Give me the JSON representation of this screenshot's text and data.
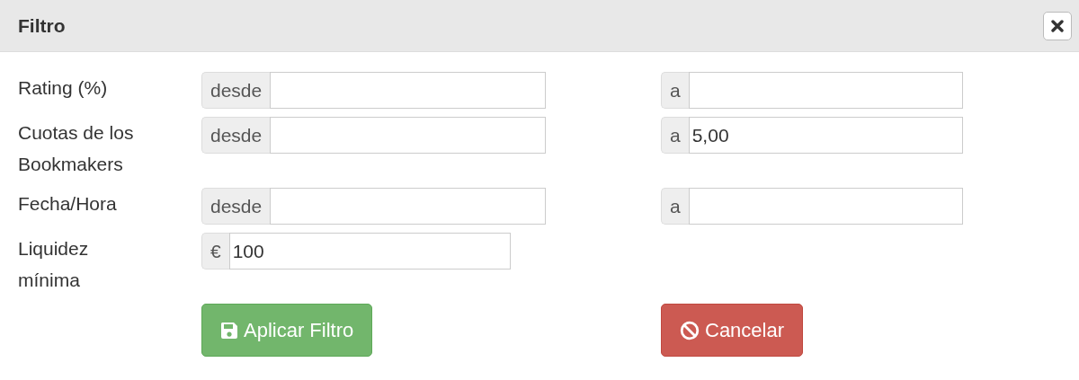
{
  "dialog": {
    "title": "Filtro"
  },
  "fields": [
    {
      "label": "Rating (%)",
      "inputs": [
        {
          "addon": "desde"
        },
        {
          "addon": "a"
        }
      ]
    },
    {
      "label": "Cuotas de los Bookmakers",
      "inputs": [
        {
          "addon": "desde"
        },
        {
          "addon": "a",
          "value": "5,00"
        }
      ]
    },
    {
      "label": "Fecha/Hora",
      "inputs": [
        {
          "addon": "desde"
        },
        {
          "addon": "a"
        }
      ]
    },
    {
      "label": "Liquidez mínima",
      "inputs": [
        {
          "addon": "€",
          "value": "100"
        }
      ]
    }
  ],
  "buttons": [
    {
      "label": "Aplicar Filtro",
      "kind": "primary"
    },
    {
      "label": "Cancelar",
      "kind": "cancel"
    }
  ]
}
